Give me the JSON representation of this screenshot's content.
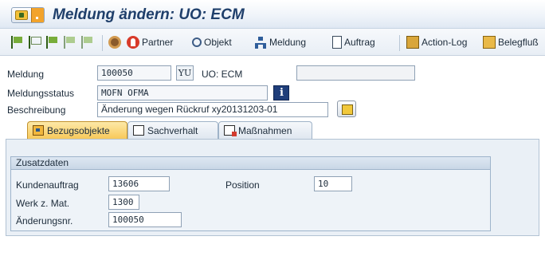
{
  "window": {
    "title": "Meldung ändern: UO: ECM"
  },
  "toolbar": {
    "items": [
      {
        "icon": "flag-icon",
        "label": ""
      },
      {
        "icon": "flag-outline-icon",
        "label": ""
      },
      {
        "icon": "flag-double-icon",
        "label": ""
      },
      {
        "icon": "flag-check-icon",
        "label": ""
      },
      {
        "icon": "flag-cancel-icon",
        "label": ""
      },
      {
        "icon": "settings-icon",
        "label": ""
      }
    ],
    "partner": "Partner",
    "objekt": "Objekt",
    "meldung": "Meldung",
    "auftrag": "Auftrag",
    "action_log": "Action-Log",
    "belegfluss": "Belegfluß"
  },
  "header": {
    "meldung_label": "Meldung",
    "meldung_value": "100050",
    "meldungsart": "YU",
    "meldung_text": "UO: ECM",
    "extra_value": "",
    "status_label": "Meldungsstatus",
    "status_value": "MOFN OFMA",
    "beschreibung_label": "Beschreibung",
    "beschreibung_value": "Änderung wegen Rückruf xy20131203-01"
  },
  "tabs": [
    {
      "label": "Bezugsobjekte",
      "active": true
    },
    {
      "label": "Sachverhalt",
      "active": false
    },
    {
      "label": "Maßnahmen",
      "active": false
    }
  ],
  "zusatzdaten": {
    "title": "Zusatzdaten",
    "kundenauftrag_label": "Kundenauftrag",
    "kundenauftrag_value": "13606",
    "position_label": "Position",
    "position_value": "10",
    "werk_label": "Werk z. Mat.",
    "werk_value": "1300",
    "aenderungsnr_label": "Änderungsnr.",
    "aenderungsnr_value": "100050"
  },
  "colors": {
    "title": "#1f3f6b",
    "active_tab": "#f8c95a",
    "panel": "#eaf0f6"
  }
}
